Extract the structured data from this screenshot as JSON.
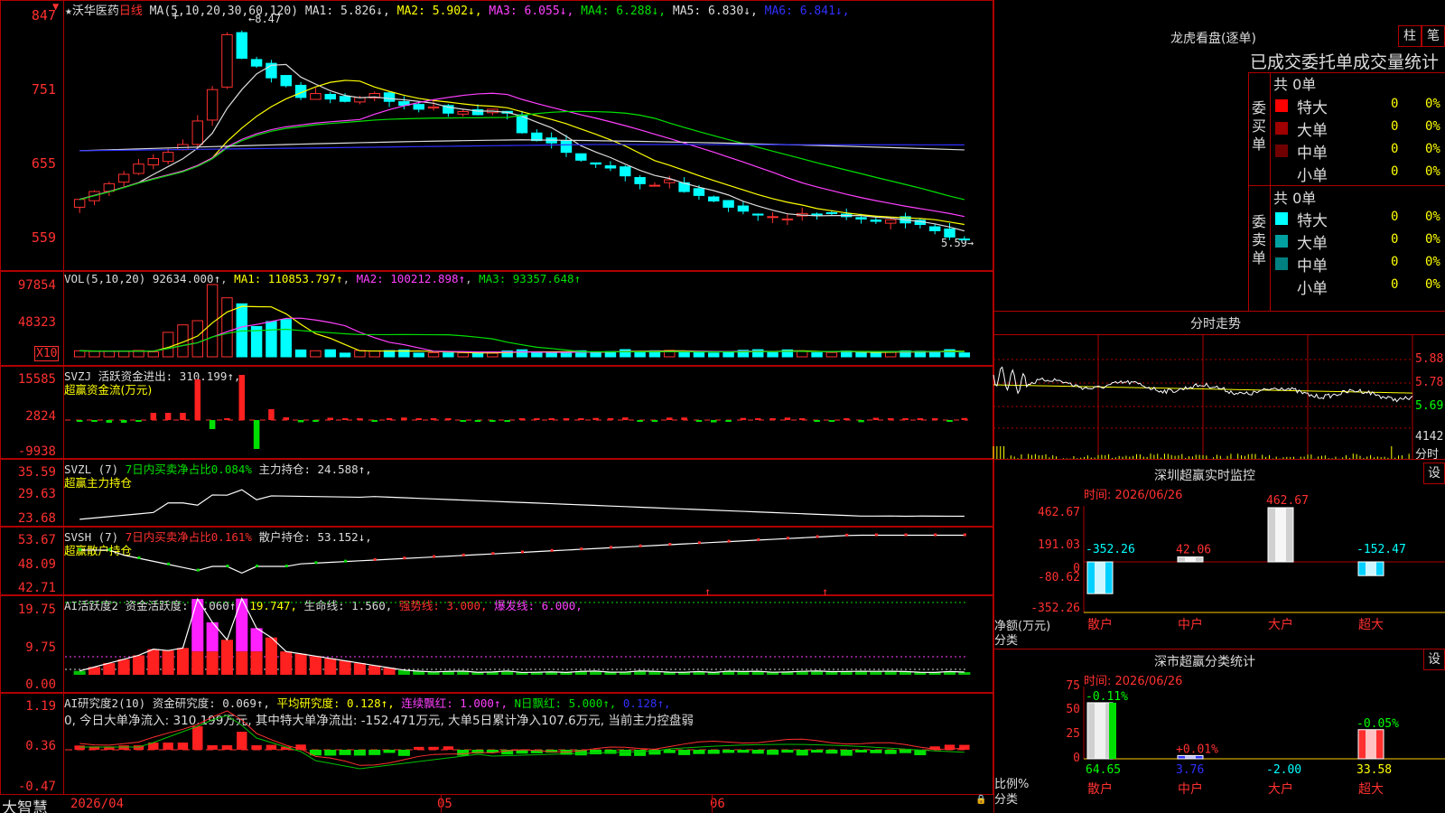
{
  "stock": {
    "name": "★沃华医药",
    "period": "日线"
  },
  "price_panel": {
    "ma_title": "MA(5,10,20,30,60,120)",
    "ma_values": [
      {
        "label": "MA1:",
        "value": "5.826↓",
        "color": "#dcdcdc"
      },
      {
        "label": "MA2:",
        "value": "5.902↓",
        "color": "#ffff00"
      },
      {
        "label": "MA3:",
        "value": "6.055↓",
        "color": "#ff40ff"
      },
      {
        "label": "MA4:",
        "value": "6.288↓",
        "color": "#00e000"
      },
      {
        "label": "MA5:",
        "value": "6.830↓",
        "color": "#dcdcdc"
      },
      {
        "label": "MA6:",
        "value": "6.841↓",
        "color": "#3030ff"
      }
    ],
    "axis": [
      "847",
      "751",
      "655",
      "559"
    ],
    "high_label": "8.47",
    "low_label": "5.59"
  },
  "vol_panel": {
    "title": "VOL(5,10,20)",
    "v": "92634.000↑",
    "ma1": "MA1: 110853.797↑",
    "ma2": "MA2: 100212.898↑",
    "ma3": "MA3: 93357.648↑",
    "axis": [
      "97854",
      "48323"
    ],
    "unit": "X10"
  },
  "svzj_panel": {
    "title": "SVZJ",
    "t1": "活跃资金进出: 310.199↑,",
    "t2": "超赢资金流(万元)",
    "axis": [
      "15585",
      "2824",
      "-9938"
    ]
  },
  "svzl_panel": {
    "title": "SVZL (7)",
    "t1": "7日内买卖净占比0.084%",
    "t2": "主力持仓: 24.588↑,",
    "t3": "超赢主力持仓",
    "axis": [
      "35.59",
      "29.63",
      "23.68"
    ]
  },
  "svsh_panel": {
    "title": "SVSH (7)",
    "t1": "7日内买卖净占比0.161%",
    "t2": "散户持仓: 53.152↓,",
    "t3": "超赢散户持仓",
    "axis": [
      "53.67",
      "48.09",
      "42.71"
    ]
  },
  "ai_panel": {
    "title": "AI活跃度2",
    "t1": "资金活跃度: 1.060↑,",
    "t2": "19.747,",
    "t3": "生命线: 1.560,",
    "t4": "强势线: 3.000,",
    "t5": "爆发线: 6.000,",
    "axis": [
      "19.75",
      "9.75",
      "0.00"
    ]
  },
  "ai2_panel": {
    "title": "AI研究度2(10)",
    "t1": "资金研究度: 0.069↑,",
    "t2": "平均研究度: 0.128↑,",
    "t3": "连续飘红: 1.000↑,",
    "t4": "N日飘红: 5.000↑,",
    "t5": "0.128↑,",
    "note": "0, 今日大单净流入: 310.199万元, 其中特大单净流出: -152.471万元, 大单5日累计净入107.6万元, 当前主力控盘弱",
    "axis": [
      "1.19",
      "0.36",
      "-0.47"
    ]
  },
  "bottom": {
    "brand": "大智慧",
    "dates": [
      "2026/04",
      "05",
      "06"
    ]
  },
  "right_top": {
    "title": "龙虎看盘(逐单)",
    "btn1": "柱",
    "btn2": "笔",
    "subtitle": "已成交委托单成交量统计",
    "buy_label": "委买单",
    "sell_label": "委卖单",
    "buy_total": "共 0单",
    "sell_total": "共 0单",
    "buy_rows": [
      {
        "name": "特大",
        "count": "0",
        "pct": "0%",
        "color": "#ff0000"
      },
      {
        "name": "大单",
        "count": "0",
        "pct": "0%",
        "color": "#a00000"
      },
      {
        "name": "中单",
        "count": "0",
        "pct": "0%",
        "color": "#700000"
      },
      {
        "name": "小单",
        "count": "0",
        "pct": "0%",
        "color": "#000000"
      }
    ],
    "sell_rows": [
      {
        "name": "特大",
        "count": "0",
        "pct": "0%",
        "color": "#00ffff"
      },
      {
        "name": "大单",
        "count": "0",
        "pct": "0%",
        "color": "#00a0a0"
      },
      {
        "name": "中单",
        "count": "0",
        "pct": "0%",
        "color": "#008080"
      },
      {
        "name": "小单",
        "count": "0",
        "pct": "0%",
        "color": "#000000"
      }
    ]
  },
  "intraday": {
    "title": "分时走势",
    "axis": [
      "5.88",
      "5.78",
      "5.69"
    ],
    "vol": "4142",
    "vol_unit": "分时"
  },
  "monitor": {
    "title": "深圳超赢实时监控",
    "btn": "设",
    "time": "时间: 2026/06/26",
    "axis": [
      "462.67",
      "191.03",
      "0",
      "-80.62",
      "-352.26"
    ],
    "ylabel": "净额(万元)",
    "xlabel": "分类",
    "bars": [
      {
        "cat": "散户",
        "value": "-352.26"
      },
      {
        "cat": "中户",
        "value": "42.06"
      },
      {
        "cat": "大户",
        "value": "462.67"
      },
      {
        "cat": "超大",
        "value": "-152.47"
      }
    ]
  },
  "stats": {
    "title": "深市超赢分类统计",
    "btn": "设",
    "time": "时间: 2026/06/26",
    "axis": [
      "75",
      "50",
      "25",
      "0"
    ],
    "ylabel": "比例%",
    "xlabel": "分类",
    "bars": [
      {
        "cat": "散户",
        "top": "-0.11%",
        "bottom": "64.65"
      },
      {
        "cat": "中户",
        "top": "+0.01%",
        "bottom": "3.76"
      },
      {
        "cat": "大户",
        "top": "",
        "bottom": "-2.00"
      },
      {
        "cat": "超大",
        "top": "-0.05%",
        "bottom": "33.58"
      }
    ]
  }
}
